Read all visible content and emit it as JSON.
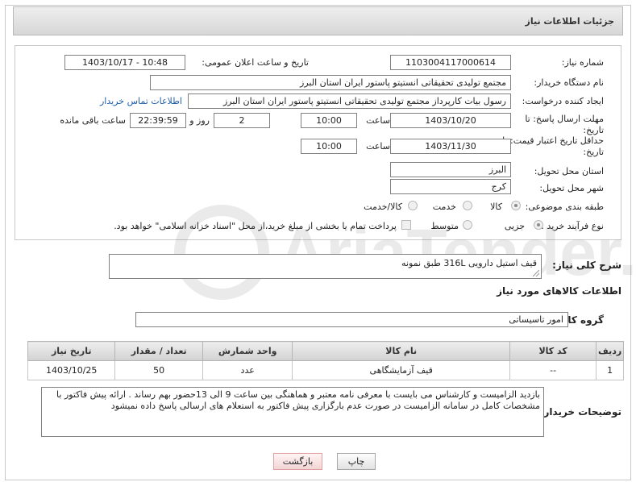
{
  "header": {
    "title": "جزئیات اطلاعات نیاز"
  },
  "fields": {
    "need_number_label": "شماره نیاز:",
    "need_number": "1103004117000614",
    "announce_label": "تاریخ و ساعت اعلان عمومی:",
    "announce_value": "1403/10/17 - 10:48",
    "buyer_org_label": "نام دستگاه خریدار:",
    "buyer_org": "مجتمع تولیدی تحقیقاتی انستیتو پاستور ایران استان البرز",
    "creator_label": "ایجاد کننده درخواست:",
    "creator": "رسول بیات کارپرداز مجتمع تولیدی تحقیقاتی انستیتو پاستور ایران استان البرز",
    "contact_link": "اطلاعات تماس خریدار",
    "deadline_label": "مهلت ارسال پاسخ: تا تاریخ:",
    "deadline_date": "1403/10/20",
    "time_label": "ساعت",
    "deadline_time": "10:00",
    "days_value": "2",
    "days_label": "روز و",
    "remaining_time": "22:39:59",
    "remaining_label": "ساعت باقی مانده",
    "validity_label": "حداقل تاریخ اعتبار قیمت: تا تاریخ:",
    "validity_date": "1403/11/30",
    "validity_time": "10:00",
    "province_label": "استان محل تحویل:",
    "province": "البرز",
    "city_label": "شهر محل تحویل:",
    "city": "کرج",
    "category_label": "طبقه بندی موضوعی:",
    "category_options": [
      "کالا",
      "خدمت",
      "کالا/خدمت"
    ],
    "process_label": "نوع فرآیند خرید :",
    "process_options": [
      "جزیی",
      "متوسط"
    ],
    "payment_note": "پرداخت تمام یا بخشی از مبلغ خرید،از محل \"اسناد خزانه اسلامی\" خواهد بود."
  },
  "description": {
    "label": "شرح کلی نیاز:",
    "value": "قیف استیل دارویی  316L   طبق نمونه"
  },
  "goods_section": {
    "title": "اطلاعات کالاهای مورد نیاز",
    "group_label": "گروه کالا:",
    "group_value": "امور تاسیساتی"
  },
  "table": {
    "headers": [
      "ردیف",
      "کد کالا",
      "نام کالا",
      "واحد شمارش",
      "تعداد / مقدار",
      "تاریخ نیاز"
    ],
    "rows": [
      [
        "1",
        "--",
        "قیف آزمایشگاهی",
        "عدد",
        "50",
        "1403/10/25"
      ]
    ]
  },
  "buyer_notes": {
    "label": "توضیحات خریدار:",
    "value": "بازدید الزامیست و کارشناس می بایست با معرفی نامه معتبر و هماهنگی بین ساعت 9 الی 13حضور بهم رساند . ارائه پیش فاکتور با مشخصات کامل در سامانه الزامیست در صورت عدم بارگزاری پیش فاکتور به استعلام های ارسالی پاسخ داده نمیشود"
  },
  "buttons": {
    "print": "چاپ",
    "back": "بازگشت"
  },
  "watermark": "AriaTender.neT"
}
